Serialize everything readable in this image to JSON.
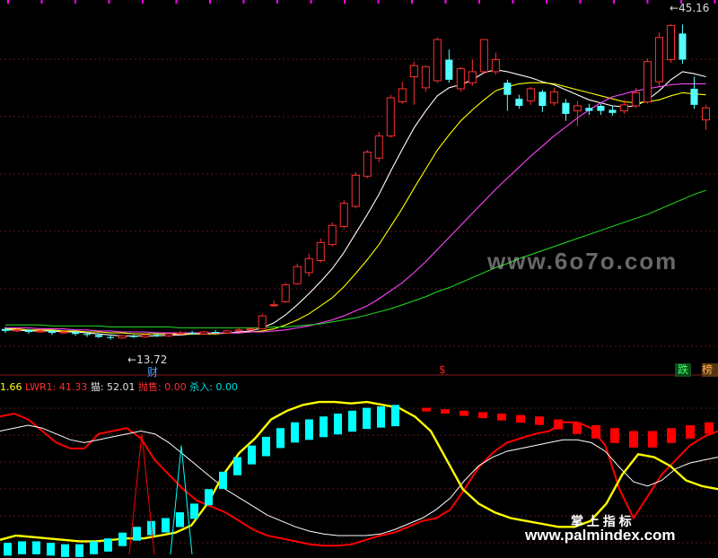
{
  "chart_data": [
    {
      "type": "candlestick",
      "panel": "price",
      "price_high_label": "45.16",
      "price_low_label": "13.72",
      "low_arrow": "←",
      "high_arrow": "←",
      "marker_cai": "财",
      "marker_s": "$",
      "badge_die": "跌",
      "badge_bang": "榜",
      "grid": true,
      "ylim": [
        12,
        47
      ],
      "candles": [
        {
          "o": 14.8,
          "c": 14.6,
          "h": 15.0,
          "l": 14.4
        },
        {
          "o": 14.6,
          "c": 14.7,
          "h": 14.9,
          "l": 14.5
        },
        {
          "o": 14.7,
          "c": 14.5,
          "h": 14.8,
          "l": 14.3
        },
        {
          "o": 14.5,
          "c": 14.6,
          "h": 14.8,
          "l": 14.4
        },
        {
          "o": 14.6,
          "c": 14.4,
          "h": 14.7,
          "l": 14.2
        },
        {
          "o": 14.4,
          "c": 14.5,
          "h": 14.7,
          "l": 14.3
        },
        {
          "o": 14.5,
          "c": 14.3,
          "h": 14.6,
          "l": 14.1
        },
        {
          "o": 14.3,
          "c": 14.2,
          "h": 14.5,
          "l": 14.0
        },
        {
          "o": 14.2,
          "c": 14.0,
          "h": 14.3,
          "l": 13.9
        },
        {
          "o": 14.0,
          "c": 13.9,
          "h": 14.2,
          "l": 13.72
        },
        {
          "o": 13.9,
          "c": 14.1,
          "h": 14.2,
          "l": 13.8
        },
        {
          "o": 14.1,
          "c": 14.0,
          "h": 14.2,
          "l": 13.9
        },
        {
          "o": 14.0,
          "c": 14.2,
          "h": 14.3,
          "l": 13.9
        },
        {
          "o": 14.2,
          "c": 14.1,
          "h": 14.4,
          "l": 14.0
        },
        {
          "o": 14.1,
          "c": 14.3,
          "h": 14.4,
          "l": 14.0
        },
        {
          "o": 14.3,
          "c": 14.4,
          "h": 14.6,
          "l": 14.2
        },
        {
          "o": 14.4,
          "c": 14.3,
          "h": 14.6,
          "l": 14.2
        },
        {
          "o": 14.3,
          "c": 14.5,
          "h": 14.6,
          "l": 14.2
        },
        {
          "o": 14.5,
          "c": 14.4,
          "h": 14.7,
          "l": 14.3
        },
        {
          "o": 14.4,
          "c": 14.6,
          "h": 14.7,
          "l": 14.3
        },
        {
          "o": 14.6,
          "c": 14.7,
          "h": 14.9,
          "l": 14.5
        },
        {
          "o": 14.7,
          "c": 14.8,
          "h": 15.0,
          "l": 14.6
        },
        {
          "o": 14.8,
          "c": 16.1,
          "h": 16.3,
          "l": 14.8
        },
        {
          "o": 17.2,
          "c": 17.2,
          "h": 17.6,
          "l": 17.0
        },
        {
          "o": 17.5,
          "c": 19.2,
          "h": 19.4,
          "l": 17.4
        },
        {
          "o": 19.3,
          "c": 21.0,
          "h": 21.3,
          "l": 19.2
        },
        {
          "o": 20.4,
          "c": 21.8,
          "h": 22.3,
          "l": 20.0
        },
        {
          "o": 21.6,
          "c": 23.4,
          "h": 23.8,
          "l": 21.4
        },
        {
          "o": 23.2,
          "c": 25.1,
          "h": 25.4,
          "l": 23.0
        },
        {
          "o": 25.0,
          "c": 27.3,
          "h": 27.6,
          "l": 24.8
        },
        {
          "o": 27.0,
          "c": 30.1,
          "h": 30.4,
          "l": 26.8
        },
        {
          "o": 30.0,
          "c": 32.4,
          "h": 32.6,
          "l": 29.8
        },
        {
          "o": 31.8,
          "c": 34.0,
          "h": 34.4,
          "l": 31.4
        },
        {
          "o": 34.0,
          "c": 37.8,
          "h": 38.1,
          "l": 33.8
        },
        {
          "o": 37.4,
          "c": 38.7,
          "h": 39.4,
          "l": 37.2
        },
        {
          "o": 39.9,
          "c": 41.0,
          "h": 41.4,
          "l": 37.1
        },
        {
          "o": 38.8,
          "c": 40.9,
          "h": 41.0,
          "l": 38.4
        },
        {
          "o": 39.5,
          "c": 43.6,
          "h": 43.8,
          "l": 39.3
        },
        {
          "o": 41.6,
          "c": 39.6,
          "h": 42.6,
          "l": 39.3
        },
        {
          "o": 38.7,
          "c": 40.7,
          "h": 40.9,
          "l": 38.4
        },
        {
          "o": 39.3,
          "c": 40.4,
          "h": 41.6,
          "l": 39.0
        },
        {
          "o": 40.4,
          "c": 43.6,
          "h": 43.6,
          "l": 40.2
        },
        {
          "o": 40.4,
          "c": 41.6,
          "h": 42.3,
          "l": 40.1
        },
        {
          "o": 39.3,
          "c": 38.1,
          "h": 39.6,
          "l": 36.5
        },
        {
          "o": 37.7,
          "c": 37.0,
          "h": 38.1,
          "l": 36.7
        },
        {
          "o": 37.5,
          "c": 38.7,
          "h": 38.9,
          "l": 37.1
        },
        {
          "o": 38.4,
          "c": 37.0,
          "h": 38.6,
          "l": 36.4
        },
        {
          "o": 37.3,
          "c": 38.4,
          "h": 38.8,
          "l": 37.0
        },
        {
          "o": 37.3,
          "c": 36.2,
          "h": 37.7,
          "l": 35.5
        },
        {
          "o": 36.5,
          "c": 37.0,
          "h": 37.5,
          "l": 35.0
        },
        {
          "o": 36.8,
          "c": 36.5,
          "h": 37.2,
          "l": 36.1
        },
        {
          "o": 37.0,
          "c": 36.5,
          "h": 37.2,
          "l": 36.1
        },
        {
          "o": 36.6,
          "c": 36.3,
          "h": 37.0,
          "l": 36.0
        },
        {
          "o": 36.5,
          "c": 37.1,
          "h": 37.6,
          "l": 36.2
        },
        {
          "o": 37.0,
          "c": 38.3,
          "h": 38.8,
          "l": 36.8
        },
        {
          "o": 37.4,
          "c": 41.4,
          "h": 41.7,
          "l": 37.2
        },
        {
          "o": 39.4,
          "c": 43.8,
          "h": 44.3,
          "l": 39.0
        },
        {
          "o": 41.6,
          "c": 45.0,
          "h": 45.16,
          "l": 41.3
        },
        {
          "o": 44.2,
          "c": 41.6,
          "h": 45.1,
          "l": 41.2
        },
        {
          "o": 38.7,
          "c": 37.1,
          "h": 39.9,
          "l": 36.7
        },
        {
          "o": 35.6,
          "c": 36.8,
          "h": 37.1,
          "l": 34.6
        }
      ],
      "ma_lines": [
        {
          "color": "#ffffff",
          "values": [
            14.7,
            14.7,
            14.6,
            14.6,
            14.6,
            14.5,
            14.5,
            14.4,
            14.3,
            14.2,
            14.1,
            14.1,
            14.1,
            14.1,
            14.2,
            14.2,
            14.3,
            14.3,
            14.4,
            14.4,
            14.5,
            14.6,
            14.9,
            15.4,
            16.2,
            17.2,
            18.3,
            19.5,
            20.8,
            22.4,
            24.3,
            26.2,
            28.2,
            30.5,
            32.7,
            34.8,
            36.5,
            38.0,
            38.8,
            39.1,
            39.6,
            40.3,
            40.6,
            40.4,
            40.1,
            39.8,
            39.4,
            39.1,
            38.6,
            38.1,
            37.6,
            37.3,
            37.0,
            36.9,
            37.0,
            37.6,
            38.5,
            39.6,
            40.4,
            40.2,
            39.9
          ]
        },
        {
          "color": "#ffff00",
          "values": [
            14.8,
            14.8,
            14.7,
            14.7,
            14.7,
            14.6,
            14.6,
            14.5,
            14.5,
            14.4,
            14.4,
            14.3,
            14.3,
            14.3,
            14.3,
            14.3,
            14.3,
            14.3,
            14.3,
            14.4,
            14.4,
            14.5,
            14.6,
            14.8,
            15.2,
            15.7,
            16.3,
            17.1,
            17.9,
            19.0,
            20.3,
            21.7,
            23.2,
            25.0,
            26.8,
            28.8,
            30.7,
            32.6,
            34.1,
            35.5,
            36.6,
            37.6,
            38.5,
            38.9,
            39.2,
            39.3,
            39.3,
            39.2,
            38.9,
            38.6,
            38.3,
            38.0,
            37.7,
            37.4,
            37.3,
            37.4,
            37.6,
            38.0,
            38.3,
            38.2,
            38.1
          ]
        },
        {
          "color": "#ff44ff",
          "values": [
            14.9,
            14.9,
            14.9,
            14.8,
            14.8,
            14.8,
            14.7,
            14.7,
            14.6,
            14.6,
            14.5,
            14.5,
            14.5,
            14.4,
            14.4,
            14.4,
            14.4,
            14.4,
            14.4,
            14.4,
            14.4,
            14.5,
            14.5,
            14.6,
            14.7,
            14.9,
            15.1,
            15.4,
            15.7,
            16.1,
            16.6,
            17.1,
            17.8,
            18.6,
            19.4,
            20.4,
            21.5,
            22.7,
            23.9,
            25.1,
            26.3,
            27.5,
            28.7,
            29.8,
            30.9,
            32.0,
            33.0,
            34.0,
            34.9,
            35.8,
            36.6,
            37.3,
            37.9,
            38.2,
            38.5,
            38.7,
            38.9,
            39.1,
            39.2,
            39.2,
            39.2
          ]
        },
        {
          "color": "#22cc22",
          "values": [
            15.2,
            15.2,
            15.2,
            15.2,
            15.1,
            15.1,
            15.1,
            15.1,
            15.1,
            15.0,
            15.0,
            15.0,
            15.0,
            15.0,
            15.0,
            14.9,
            14.9,
            14.9,
            14.9,
            14.9,
            14.9,
            14.9,
            14.9,
            15.0,
            15.0,
            15.1,
            15.2,
            15.3,
            15.5,
            15.7,
            15.9,
            16.2,
            16.5,
            16.8,
            17.2,
            17.6,
            18.0,
            18.5,
            18.9,
            19.4,
            19.9,
            20.4,
            20.9,
            21.3,
            21.8,
            22.2,
            22.6,
            23.0,
            23.4,
            23.8,
            24.2,
            24.6,
            25.0,
            25.4,
            25.8,
            26.2,
            26.7,
            27.2,
            27.7,
            28.2,
            28.6
          ]
        }
      ]
    },
    {
      "type": "line",
      "panel": "indicator",
      "label_item1": "1.66",
      "label_lwr1": "LWR1: 41.33",
      "label_mao": "猫: 52.01",
      "label_paoshou": "抛售: 0.00",
      "label_sharu": "杀入: 0.00",
      "ylim": [
        -5,
        105
      ],
      "grid": true,
      "series": [
        {
          "color": "#ff0000",
          "values": [
            90,
            92,
            88,
            80,
            72,
            68,
            68,
            78,
            80,
            82,
            75,
            60,
            50,
            40,
            32,
            28,
            24,
            18,
            12,
            8,
            6,
            4,
            2,
            1,
            1,
            2,
            5,
            8,
            10,
            14,
            18,
            20,
            26,
            40,
            55,
            65,
            72,
            75,
            78,
            80,
            86,
            86,
            82,
            70,
            40,
            20,
            35,
            50,
            60,
            70,
            76,
            80
          ]
        },
        {
          "color": "#ffffff",
          "values": [
            80,
            82,
            84,
            82,
            78,
            74,
            72,
            74,
            76,
            78,
            80,
            78,
            72,
            64,
            56,
            48,
            40,
            34,
            28,
            22,
            18,
            14,
            11,
            9,
            8,
            8,
            8,
            9,
            12,
            16,
            20,
            26,
            34,
            46,
            56,
            62,
            66,
            68,
            70,
            72,
            74,
            74,
            72,
            66,
            55,
            45,
            42,
            46,
            54,
            58,
            60,
            62
          ]
        },
        {
          "color": "#ffff00",
          "values": [
            5,
            8,
            7,
            6,
            5,
            4,
            4,
            5,
            6,
            6,
            8,
            10,
            15,
            30,
            50,
            65,
            75,
            88,
            94,
            98,
            100,
            100,
            99,
            100,
            98,
            96,
            90,
            80,
            60,
            40,
            30,
            24,
            20,
            18,
            16,
            14,
            14,
            18,
            30,
            50,
            64,
            62,
            56,
            46,
            42,
            40
          ]
        }
      ],
      "bars": [
        {
          "color": "#00ffff",
          "values": [
            3,
            4,
            4,
            3,
            2,
            2,
            4,
            6,
            10,
            14,
            18,
            20,
            24,
            30,
            40,
            52,
            62,
            70,
            76,
            82,
            86,
            88,
            90,
            92,
            94,
            96,
            97,
            98
          ]
        },
        {
          "color": "#ff0000",
          "values": [
            96,
            95,
            94,
            93,
            92,
            91,
            90,
            88,
            86,
            84,
            82,
            80,
            80,
            82,
            84,
            86
          ]
        }
      ],
      "spikes": [
        {
          "color": "#ff0000",
          "value": 78
        },
        {
          "color": "#00ffff",
          "value": 70
        }
      ]
    }
  ],
  "watermark_top": "www.6o7o.com",
  "watermark_cn": "掌 上 指 标",
  "watermark_bottom": "www.palmindex.com"
}
